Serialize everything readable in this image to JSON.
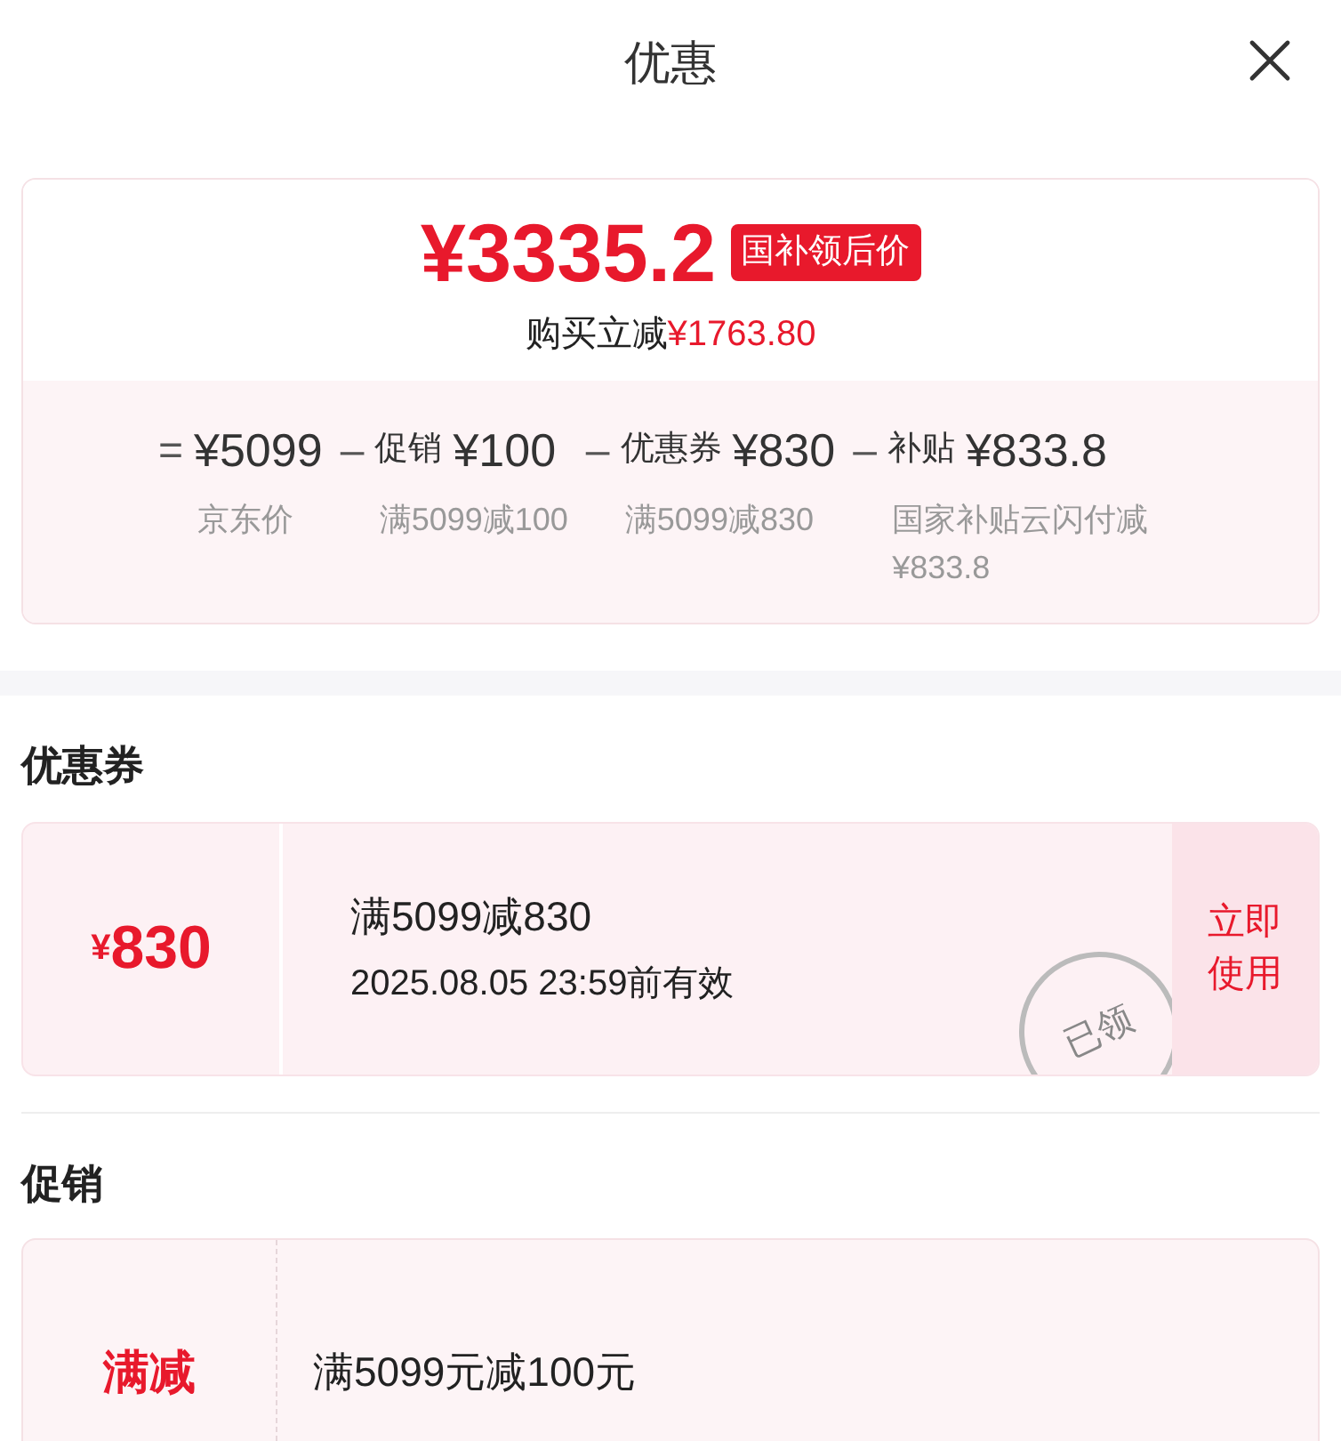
{
  "header": {
    "title": "优惠"
  },
  "summary": {
    "price": "¥3335.2",
    "badge": "国补领后价",
    "saving_label": "购买立减",
    "saving_amount": "¥1763.80",
    "breakdown": [
      {
        "operator": "=",
        "amount": "¥5099",
        "note": "京东价"
      },
      {
        "operator": "–",
        "label": "促销",
        "amount": "¥100",
        "note": "满5099减100"
      },
      {
        "operator": "–",
        "label": "优惠券",
        "amount": "¥830",
        "note": "满5099减830"
      },
      {
        "operator": "–",
        "label": "补贴",
        "amount": "¥833.8",
        "note": "国家补贴云闪付减¥833.8"
      }
    ]
  },
  "coupons": {
    "heading": "优惠券",
    "items": [
      {
        "currency": "¥",
        "value": "830",
        "title": "满5099减830",
        "validity": "2025.08.05 23:59前有效",
        "action": "立即使用",
        "stamp": "已领"
      }
    ]
  },
  "promotions": {
    "heading": "促销",
    "items": [
      {
        "tag": "满减",
        "description": "满5099元减100元"
      }
    ]
  }
}
